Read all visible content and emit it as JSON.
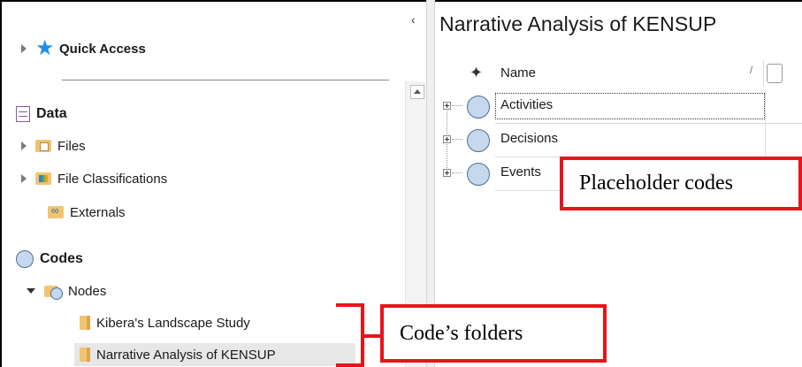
{
  "nav": {
    "quick_access": "Quick Access",
    "data_section": "Data",
    "data_items": [
      "Files",
      "File Classifications",
      "Externals"
    ],
    "codes_section": "Codes",
    "nodes": "Nodes",
    "node_folders": [
      "Kibera's Landscape Study",
      "Narrative Analysis of KENSUP"
    ],
    "selected": "Narrative Analysis of KENSUP"
  },
  "content": {
    "title": "Narrative Analysis of KENSUP",
    "columns": {
      "name": "Name",
      "sort_indicator": "/"
    },
    "rows": [
      "Activities",
      "Decisions",
      "Events"
    ]
  },
  "annotations": {
    "placeholder_codes": "Placeholder codes",
    "code_folders": "Code’s folders",
    "color": "#e8141b"
  },
  "icons": {
    "quick_access": "star-icon",
    "data": "database-icon",
    "codes": "code-circle-icon"
  }
}
